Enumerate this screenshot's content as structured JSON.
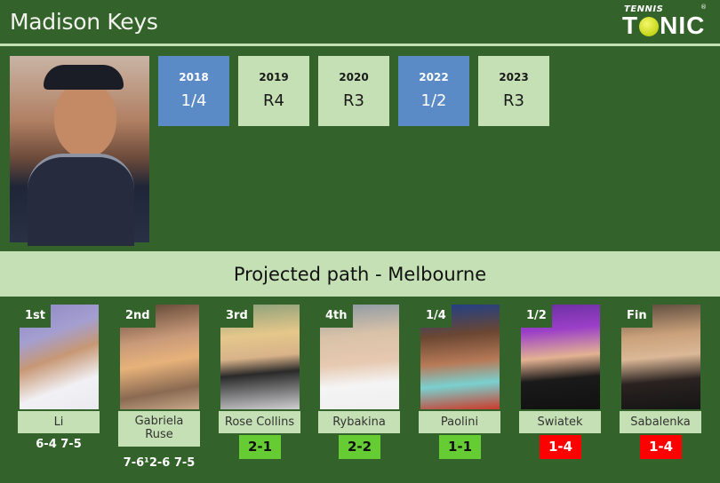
{
  "header": {
    "player_name": "Madison Keys",
    "logo": {
      "small_text": "TENNIS",
      "big_text_left": "T",
      "big_text_right": "NIC",
      "registered": "®",
      "ball_icon": "tennis-ball-icon"
    }
  },
  "player_photo": {
    "alt": "Madison Keys photo"
  },
  "history": [
    {
      "year": "2018",
      "result": "1/4",
      "highlight": true
    },
    {
      "year": "2019",
      "result": "R4",
      "highlight": false
    },
    {
      "year": "2020",
      "result": "R3",
      "highlight": false
    },
    {
      "year": "2022",
      "result": "1/2",
      "highlight": true
    },
    {
      "year": "2023",
      "result": "R3",
      "highlight": false
    }
  ],
  "band": {
    "title": "Projected path - Melbourne"
  },
  "colors": {
    "background": "#33632a",
    "light_green": "#c5e0b4",
    "blue": "#5b8bc6",
    "win": "#66cc33",
    "lose": "#ff0000"
  },
  "path": [
    {
      "round": "1st",
      "name": "Li",
      "score": "6-4 7-5",
      "h2h": null
    },
    {
      "round": "2nd",
      "name": "Gabriela Ruse",
      "score": "7-6¹2-6 7-5",
      "h2h": null
    },
    {
      "round": "3rd",
      "name": "Rose Collins",
      "score": null,
      "h2h": "2-1",
      "h2h_status": "win"
    },
    {
      "round": "4th",
      "name": "Rybakina",
      "score": null,
      "h2h": "2-2",
      "h2h_status": "win"
    },
    {
      "round": "1/4",
      "name": "Paolini",
      "score": null,
      "h2h": "1-1",
      "h2h_status": "win"
    },
    {
      "round": "1/2",
      "name": "Swiatek",
      "score": null,
      "h2h": "1-4",
      "h2h_status": "lose"
    },
    {
      "round": "Fin",
      "name": "Sabalenka",
      "score": null,
      "h2h": "1-4",
      "h2h_status": "lose"
    }
  ]
}
